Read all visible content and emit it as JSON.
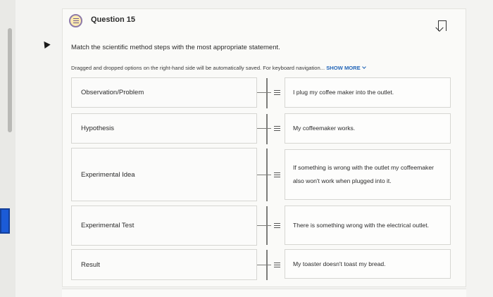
{
  "question": {
    "title": "Question 15",
    "prompt": "Match the scientific method steps with the most appropriate statement.",
    "note": "Dragged and dropped options on the right-hand side will be automatically saved. For keyboard navigation...",
    "show_more": "SHOW MORE"
  },
  "pairs": [
    {
      "left": "Observation/Problem",
      "right": "I plug my coffee maker into the outlet."
    },
    {
      "left": "Hypothesis",
      "right": "My coffeemaker works."
    },
    {
      "left": "Experimental Idea",
      "right": "If something is wrong with the outlet my coffeemaker also won't work when plugged into it."
    },
    {
      "left": "Experimental Test",
      "right": "There is something wrong with the electrical outlet."
    },
    {
      "left": "Result",
      "right": "My toaster doesn't toast my bread."
    }
  ],
  "icons": {
    "question_icon": "list-icon",
    "bookmark_icon": "bookmark-icon",
    "drag_handle": "drag-handle-icon"
  }
}
